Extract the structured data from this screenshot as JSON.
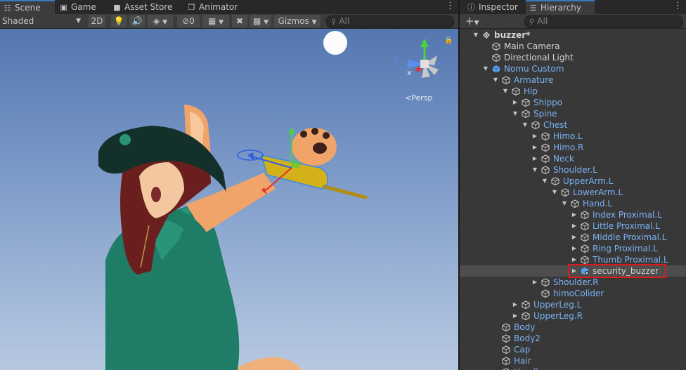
{
  "scene_tabs": [
    {
      "label": "Scene",
      "icon": "grid-icon"
    },
    {
      "label": "Game",
      "icon": "gamepad-icon"
    },
    {
      "label": "Asset Store",
      "icon": "store-icon"
    },
    {
      "label": "Animator",
      "icon": "animator-icon"
    }
  ],
  "scene_toolbar": {
    "shading_mode": "Shaded",
    "mode_2d": "2D",
    "hidden_count": "0",
    "gizmos": "Gizmos",
    "search_placeholder": "All"
  },
  "viewport": {
    "projection": "Persp",
    "axis_labels": {
      "x": "x",
      "y": "y",
      "z": "z"
    }
  },
  "inspector_tabs": [
    {
      "label": "Inspector",
      "icon": "info-icon"
    },
    {
      "label": "Hierarchy",
      "icon": "hierarchy-icon"
    }
  ],
  "hierarchy": {
    "add_label": "+",
    "search_placeholder": "All",
    "items": [
      {
        "label": "buzzer*",
        "depth": 0,
        "expanded": true,
        "kind": "scene",
        "color": "white"
      },
      {
        "label": "Main Camera",
        "depth": 1,
        "expanded": null,
        "kind": "object",
        "color": "white"
      },
      {
        "label": "Directional Light",
        "depth": 1,
        "expanded": null,
        "kind": "object",
        "color": "white"
      },
      {
        "label": "Nomu Custom",
        "depth": 1,
        "expanded": true,
        "kind": "prefab",
        "color": "blue"
      },
      {
        "label": "Armature",
        "depth": 2,
        "expanded": true,
        "kind": "prefab-child",
        "color": "blue"
      },
      {
        "label": "Hip",
        "depth": 3,
        "expanded": true,
        "kind": "prefab-child",
        "color": "blue"
      },
      {
        "label": "Shippo",
        "depth": 4,
        "expanded": false,
        "kind": "prefab-child",
        "color": "blue"
      },
      {
        "label": "Spine",
        "depth": 4,
        "expanded": true,
        "kind": "prefab-child",
        "color": "blue"
      },
      {
        "label": "Chest",
        "depth": 5,
        "expanded": true,
        "kind": "prefab-child",
        "color": "blue"
      },
      {
        "label": "Himo.L",
        "depth": 6,
        "expanded": false,
        "kind": "prefab-child",
        "color": "blue"
      },
      {
        "label": "Himo.R",
        "depth": 6,
        "expanded": false,
        "kind": "prefab-child",
        "color": "blue"
      },
      {
        "label": "Neck",
        "depth": 6,
        "expanded": false,
        "kind": "prefab-child",
        "color": "blue"
      },
      {
        "label": "Shoulder.L",
        "depth": 6,
        "expanded": true,
        "kind": "prefab-child",
        "color": "blue"
      },
      {
        "label": "UpperArm.L",
        "depth": 7,
        "expanded": true,
        "kind": "prefab-child",
        "color": "blue"
      },
      {
        "label": "LowerArm.L",
        "depth": 8,
        "expanded": true,
        "kind": "prefab-child",
        "color": "blue"
      },
      {
        "label": "Hand.L",
        "depth": 9,
        "expanded": true,
        "kind": "prefab-child",
        "color": "blue"
      },
      {
        "label": "Index Proximal.L",
        "depth": 10,
        "expanded": false,
        "kind": "prefab-child",
        "color": "blue"
      },
      {
        "label": "Little Proximal.L",
        "depth": 10,
        "expanded": false,
        "kind": "prefab-child",
        "color": "blue"
      },
      {
        "label": "Middle Proximal.L",
        "depth": 10,
        "expanded": false,
        "kind": "prefab-child",
        "color": "blue"
      },
      {
        "label": "Ring Proximal.L",
        "depth": 10,
        "expanded": false,
        "kind": "prefab-child",
        "color": "blue"
      },
      {
        "label": "Thumb Proximal.L",
        "depth": 10,
        "expanded": false,
        "kind": "prefab-child",
        "color": "blue"
      },
      {
        "label": "security_buzzer",
        "depth": 10,
        "expanded": false,
        "kind": "prefab-added",
        "color": "white",
        "selected": true
      },
      {
        "label": "Shoulder.R",
        "depth": 6,
        "expanded": false,
        "kind": "prefab-child",
        "color": "blue"
      },
      {
        "label": "himoColider",
        "depth": 6,
        "expanded": null,
        "kind": "prefab-child",
        "color": "blue"
      },
      {
        "label": "UpperLeg.L",
        "depth": 4,
        "expanded": false,
        "kind": "prefab-child",
        "color": "blue"
      },
      {
        "label": "UpperLeg.R",
        "depth": 4,
        "expanded": false,
        "kind": "prefab-child",
        "color": "blue"
      },
      {
        "label": "Body",
        "depth": 2,
        "expanded": null,
        "kind": "prefab-child",
        "color": "blue"
      },
      {
        "label": "Body2",
        "depth": 2,
        "expanded": null,
        "kind": "prefab-child",
        "color": "blue"
      },
      {
        "label": "Cap",
        "depth": 2,
        "expanded": null,
        "kind": "prefab-child",
        "color": "blue"
      },
      {
        "label": "Hair",
        "depth": 2,
        "expanded": null,
        "kind": "prefab-child",
        "color": "blue"
      },
      {
        "label": "Headle",
        "depth": 2,
        "expanded": null,
        "kind": "prefab-child",
        "color": "blue"
      }
    ]
  },
  "colors": {
    "prefab_blue": "#7cb2f3",
    "selection_outline": "#e01818",
    "active_tab_accent": "#3a79bb"
  }
}
